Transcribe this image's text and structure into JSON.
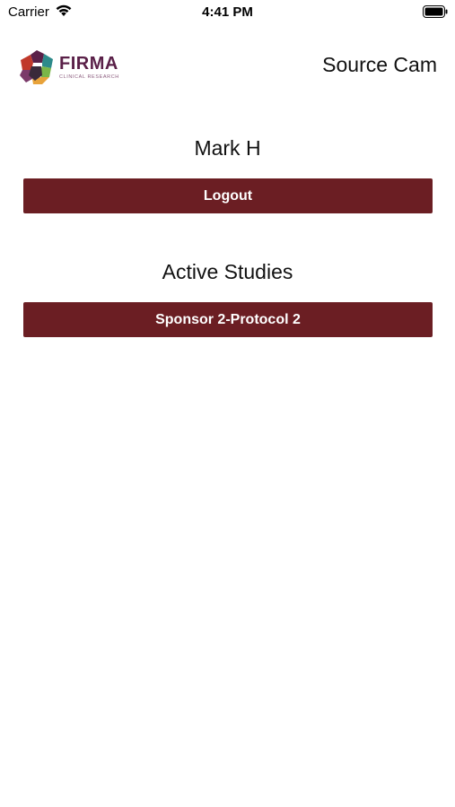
{
  "status_bar": {
    "carrier": "Carrier",
    "time": "4:41 PM",
    "wifi_icon": "wifi-icon",
    "battery_icon": "battery-icon"
  },
  "header": {
    "logo": {
      "name": "FIRMA",
      "subtitle": "CLINICAL RESEARCH",
      "colors": [
        "#5a2048",
        "#2d8a8a",
        "#7ab648",
        "#e8a33a",
        "#c0392b",
        "#3a2a3a"
      ]
    },
    "title": "Source Cam"
  },
  "user": {
    "name": "Mark H",
    "logout_label": "Logout"
  },
  "studies": {
    "title": "Active Studies",
    "items": [
      {
        "label": "Sponsor 2-Protocol 2"
      }
    ]
  },
  "colors": {
    "button_bg": "#6b1e23",
    "button_text": "#ffffff",
    "brand": "#5a2048"
  }
}
